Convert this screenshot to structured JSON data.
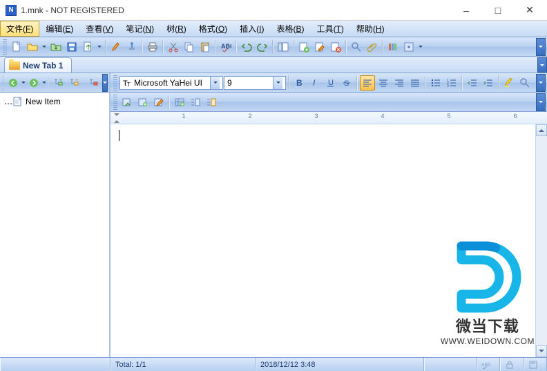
{
  "window": {
    "title": "1.mnk - NOT REGISTERED"
  },
  "menu": {
    "items": [
      {
        "label": "文件",
        "key": "F"
      },
      {
        "label": "编辑",
        "key": "E"
      },
      {
        "label": "查看",
        "key": "V"
      },
      {
        "label": "笔记",
        "key": "N"
      },
      {
        "label": "树",
        "key": "R"
      },
      {
        "label": "格式",
        "key": "O"
      },
      {
        "label": "插入",
        "key": "I"
      },
      {
        "label": "表格",
        "key": "B"
      },
      {
        "label": "工具",
        "key": "T"
      },
      {
        "label": "帮助",
        "key": "H"
      }
    ]
  },
  "tabs": {
    "active": "New Tab 1"
  },
  "tree": {
    "items": [
      "New Item"
    ]
  },
  "format": {
    "font_name": "Microsoft YaHei UI",
    "font_size": "9"
  },
  "ruler": {
    "numbers": [
      "1",
      "2",
      "3",
      "4",
      "5",
      "6"
    ]
  },
  "status": {
    "left_blank": "",
    "total": "Total: 1/1",
    "datetime": "2018/12/12 3:48"
  },
  "watermark": {
    "cn": "微当下载",
    "url": "WWW.WEIDOWN.COM"
  },
  "icons": {
    "new": "new",
    "open": "open",
    "save": "save",
    "saveall": "saveall",
    "export": "export",
    "print": "print",
    "preview": "preview",
    "cut": "cut",
    "copy": "copy",
    "paste": "paste",
    "spell": "spell",
    "undo": "undo",
    "redo": "redo",
    "tree": "tree",
    "addnote": "addnote",
    "editnote": "editnote",
    "delnote": "delnote",
    "find": "find",
    "attach": "attach",
    "books": "books",
    "opts": "opts",
    "back": "back",
    "fwd": "fwd",
    "addchild": "addchild",
    "addsib": "addsib",
    "del": "del",
    "bold": "bold",
    "italic": "italic",
    "underline": "underline",
    "strike": "strike",
    "alignl": "alignl",
    "alignc": "alignc",
    "alignr": "alignr",
    "alignj": "alignj",
    "bullets": "bullets",
    "numbers": "numbers",
    "outdent": "outdent",
    "indent": "indent",
    "hl": "hl",
    "findt": "findt",
    "r1": "r1",
    "r2": "r2",
    "r3": "r3",
    "r4": "r4",
    "r5": "r5",
    "r6": "r6"
  }
}
